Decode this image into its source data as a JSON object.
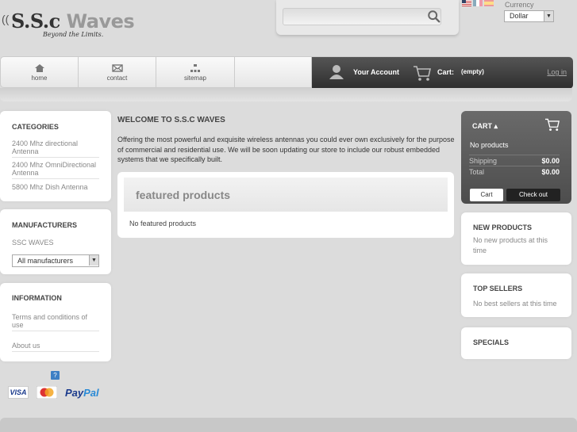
{
  "header": {
    "logo_main": "S.S.c",
    "logo_waves": "Waves",
    "logo_tagline": "Beyond the Limits.",
    "search_placeholder": "",
    "currency_label": "Currency",
    "currency_value": "Dollar"
  },
  "nav": {
    "items": [
      {
        "label": "home",
        "icon": "home-icon"
      },
      {
        "label": "contact",
        "icon": "mail-icon"
      },
      {
        "label": "sitemap",
        "icon": "sitemap-icon"
      }
    ],
    "account_label": "Your Account",
    "cart_label": "Cart:",
    "cart_qty": "(empty)",
    "login_label": "Log in"
  },
  "left": {
    "categories": {
      "title": "CATEGORIES",
      "items": [
        "2400 Mhz directional Antenna",
        "2400 Mhz OmniDirectional Antenna",
        "5800 Mhz Dish Antenna"
      ]
    },
    "manufacturers": {
      "title": "MANUFACTURERS",
      "items": [
        "SSC WAVES"
      ],
      "select_value": "All manufacturers"
    },
    "information": {
      "title": "INFORMATION",
      "items": [
        "Terms and conditions of use",
        "About us"
      ]
    },
    "payments": {
      "visa": "VISA",
      "paypal_a": "Pay",
      "paypal_b": "Pal"
    }
  },
  "center": {
    "welcome_title": "WELCOME TO S.S.C WAVES",
    "welcome_text": "Offering the most powerful and exquisite wireless antennas you could ever own exclusively for the purpose of commercial and residential use. We will be soon updating our store to include our robust embedded systems that we specifically built.",
    "featured_title": "featured products",
    "featured_empty": "No featured products"
  },
  "right": {
    "cart": {
      "title": "CART",
      "no_products": "No products",
      "shipping_label": "Shipping",
      "shipping_value": "$0.00",
      "total_label": "Total",
      "total_value": "$0.00",
      "cart_button": "Cart",
      "checkout_button": "Check out"
    },
    "new_products": {
      "title": "NEW PRODUCTS",
      "text": "No new products at this time"
    },
    "top_sellers": {
      "title": "TOP SELLERS",
      "text": "No best sellers at this time"
    },
    "specials": {
      "title": "SPECIALS"
    }
  },
  "colors": {
    "accent_dark": "#4d4d4d",
    "paypal_blue": "#1a3a8c"
  }
}
